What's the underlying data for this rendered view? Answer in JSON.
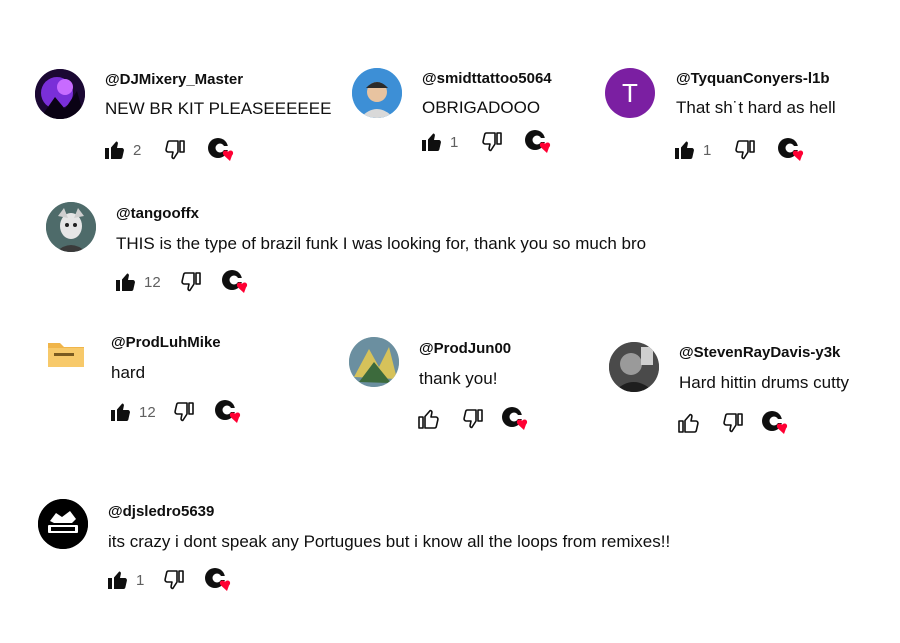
{
  "comments": [
    {
      "handle": "@DJMixery_Master",
      "text": "NEW BR KIT PLEASEEEEEE",
      "likes": "2",
      "avatar": "purple-creature-avatar",
      "liked": true
    },
    {
      "handle": "@smidttattoo5064",
      "text": "OBRIGADOOO",
      "likes": "1",
      "avatar": "man-cap-avatar",
      "liked": true
    },
    {
      "handle": "@TyquanConyers-l1b",
      "text": "That sh˙t hard as hell",
      "likes": "1",
      "avatar": "letter-T-avatar",
      "letter": "T",
      "liked": true
    },
    {
      "handle": "@tangooffx",
      "text": "THIS is the type of brazil funk I was looking for, thank you so much bro",
      "likes": "12",
      "avatar": "cartoon-girl-avatar",
      "liked": true
    },
    {
      "handle": "@ProdLuhMike",
      "text": "hard",
      "likes": "12",
      "avatar": "folder-avatar",
      "liked": true
    },
    {
      "handle": "@ProdJun00",
      "text": "thank you!",
      "likes": "",
      "avatar": "art-avatar",
      "liked": false
    },
    {
      "handle": "@StevenRayDavis-y3k",
      "text": "Hard hittin drums cutty",
      "likes": "",
      "avatar": "bw-photo-avatar",
      "liked": false
    },
    {
      "handle": "@djsledro5639",
      "text": "its crazy i dont speak any Portugues but i know all the loops from remixes!!",
      "likes": "1",
      "avatar": "sledro-logo-avatar",
      "liked": true
    }
  ],
  "colors": {
    "heart": "#ff0033",
    "letter_avatar_bg": "#7b1fa2",
    "count": "#606060"
  }
}
